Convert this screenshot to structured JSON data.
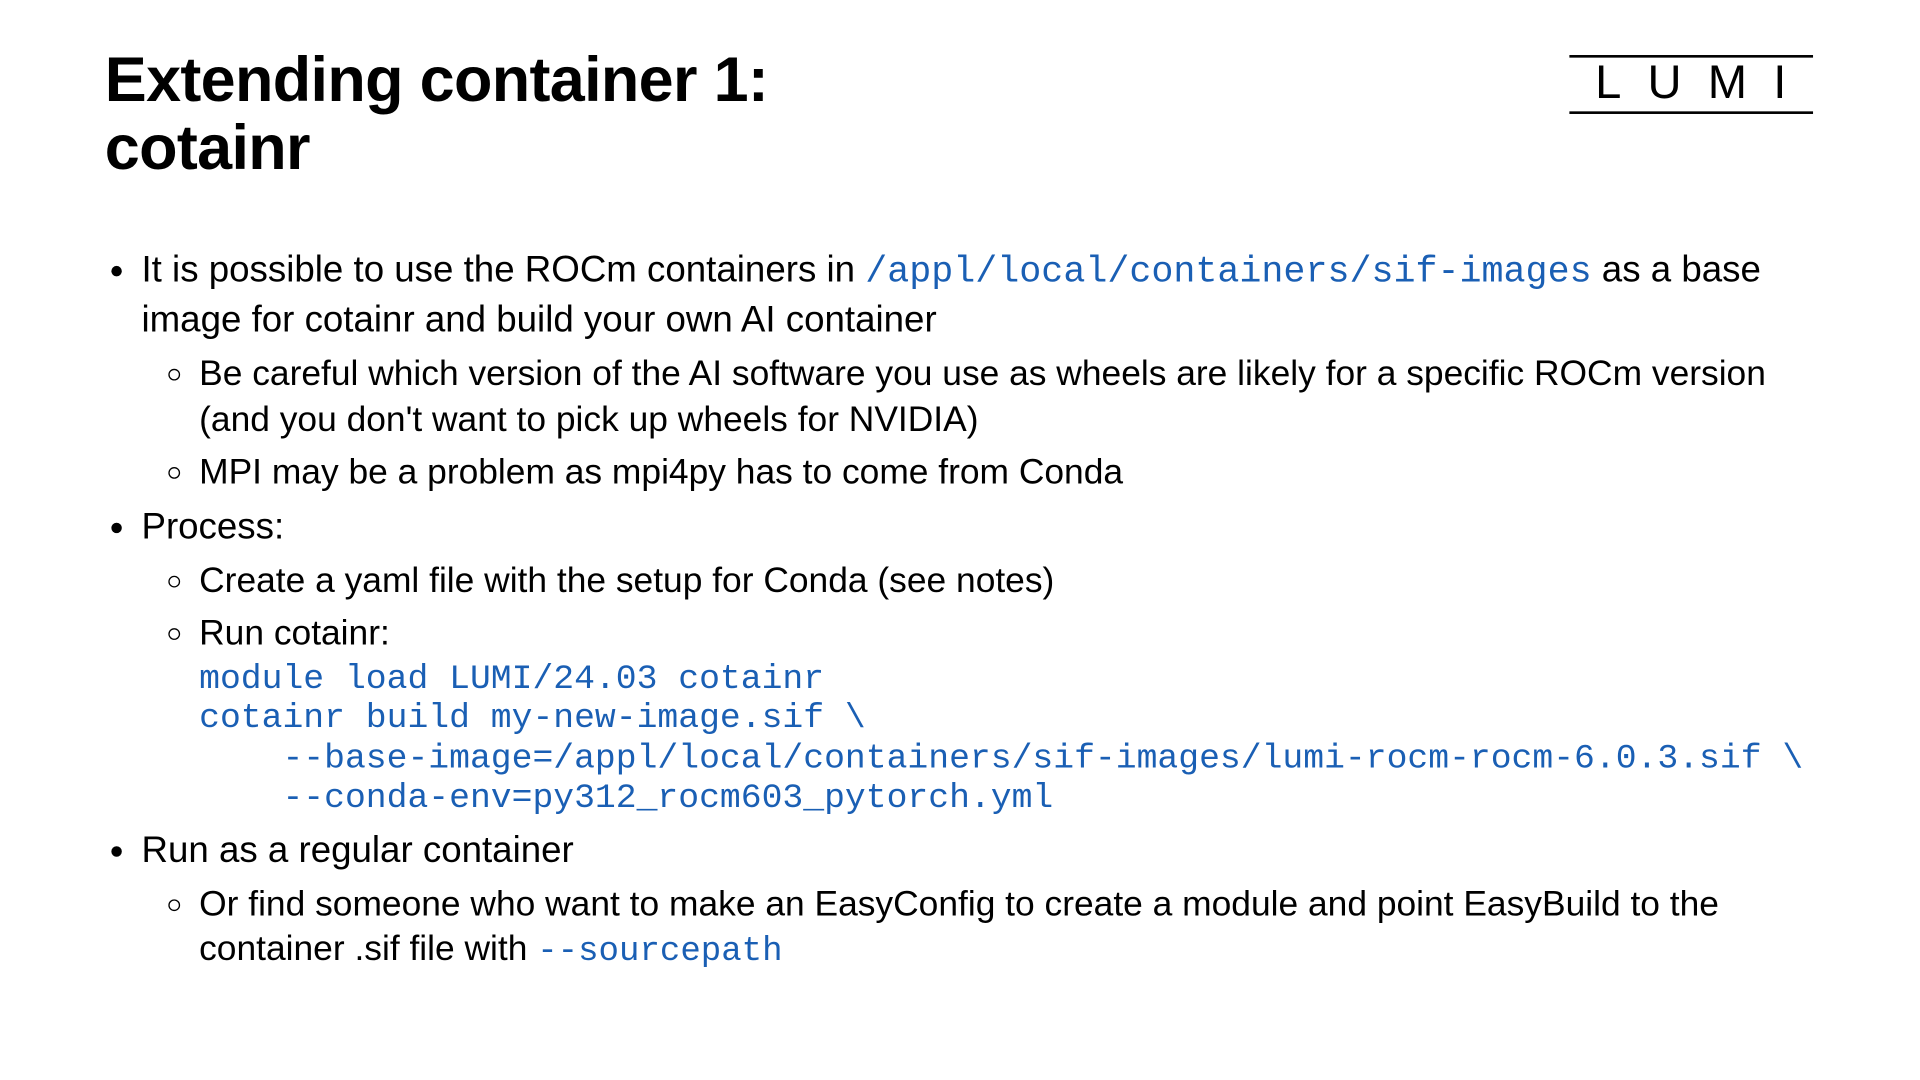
{
  "title_line1": "Extending container 1:",
  "title_line2": "cotainr",
  "logo": "LUMI",
  "bullets": {
    "b1_pre": "It is possible to use the ROCm containers in ",
    "b1_code": "/appl/local/containers/sif-images",
    "b1_post": " as a base image for cotainr and build your own AI container",
    "b1_sub1": "Be careful which version of the AI software you use as wheels are likely for a specific ROCm version (and you don't want to pick up wheels for NVIDIA)",
    "b1_sub2": "MPI may be a problem as mpi4py has to come from Conda",
    "b2": "Process:",
    "b2_sub1": "Create a yaml file with the setup for Conda (see notes)",
    "b2_sub2_label": "Run cotainr:",
    "b2_sub2_code": "module load LUMI/24.03 cotainr\ncotainr build my-new-image.sif \\\n    --base-image=/appl/local/containers/sif-images/lumi-rocm-rocm-6.0.3.sif \\\n    --conda-env=py312_rocm603_pytorch.yml",
    "b3": "Run as a regular container",
    "b3_sub1_pre": "Or find someone who want to make an EasyConfig to create a module and point EasyBuild to the container .sif file with ",
    "b3_sub1_code": "--sourcepath"
  }
}
